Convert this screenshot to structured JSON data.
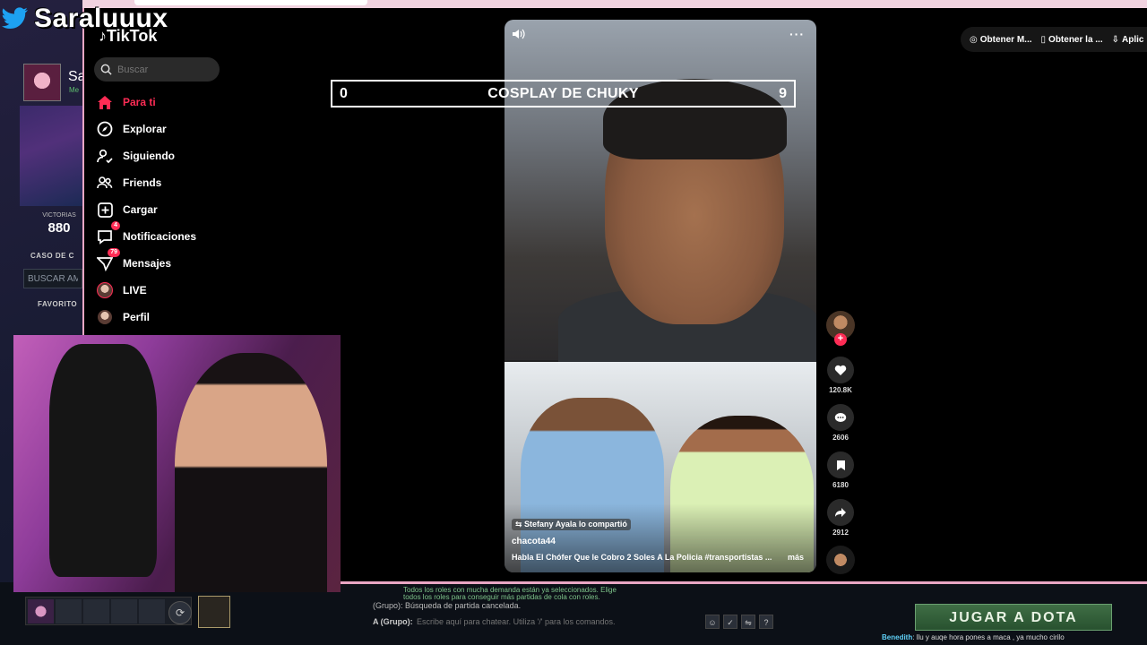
{
  "overlay": {
    "streamer_name": "Saraluuux"
  },
  "tiktok": {
    "logo": "TikTok",
    "search_placeholder": "Buscar",
    "nav": [
      {
        "label": "Para ti",
        "icon": "home-icon",
        "active": true
      },
      {
        "label": "Explorar",
        "icon": "compass-icon"
      },
      {
        "label": "Siguiendo",
        "icon": "following-icon"
      },
      {
        "label": "Friends",
        "icon": "friends-icon"
      },
      {
        "label": "Cargar",
        "icon": "upload-icon"
      },
      {
        "label": "Notificaciones",
        "icon": "notifications-icon",
        "badge": "4"
      },
      {
        "label": "Mensajes",
        "icon": "messages-icon",
        "badge": "79"
      },
      {
        "label": "LIVE",
        "icon": "live-avatar-icon"
      },
      {
        "label": "Perfil",
        "icon": "profile-avatar-icon"
      }
    ],
    "header_buttons": [
      "Obtener M...",
      "Obtener la ...",
      "Aplic"
    ],
    "video": {
      "share_text": "Stefany Ayala lo compartió",
      "author": "chacota44",
      "caption": "Habla El Chófer Que le Cobro 2 Soles A La Policia #transportistas ...",
      "more": "más"
    },
    "actions": {
      "likes": "120.8K",
      "comments": "2606",
      "saves": "6180",
      "shares": "2912"
    }
  },
  "scoreboard": {
    "left": "0",
    "title": "COSPLAY DE CHUKY",
    "right": "9"
  },
  "dota": {
    "player_name": "Sa",
    "player_status": "Me",
    "wins_label": "VICTORIAS",
    "wins_value": "880",
    "case_label": "CASO DE C",
    "search_friends": "BUSCAR AM",
    "favorites_label": "FAVORITO",
    "chat": {
      "line1": "Todos los roles con mucha demanda están ya seleccionados. Elige",
      "line2": "todos los roles para conseguir más partidas de cola con roles.",
      "line3": "(Grupo): Búsqueda de partida cancelada.",
      "input_label": "A (Grupo):",
      "input_placeholder": "Escribe aquí para chatear. Utiliza '/' para los comandos."
    },
    "play_button": "JUGAR A DOTA",
    "ticker_user": "Benedith",
    "ticker_text": ": llu y auqe hora pones a maca , ya mucho cirilo"
  },
  "colors": {
    "tiktok_red": "#fe2c55",
    "play_green": "#3f6e45",
    "frame_pink": "#e9a6c4"
  }
}
